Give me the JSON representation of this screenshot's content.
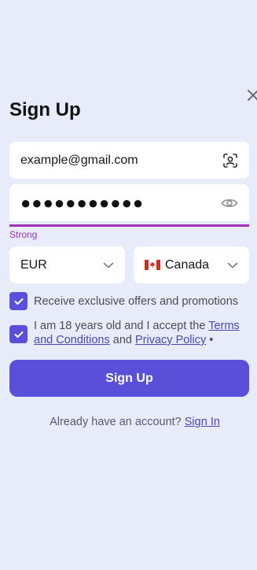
{
  "title": "Sign Up",
  "email": {
    "value": "example@gmail.com",
    "icon": "face-scan-icon"
  },
  "password": {
    "masked_value": "●●●●●●●●●●●",
    "icon": "eye-icon",
    "strength_label": "Strong",
    "strength_color": "#a034b9"
  },
  "currency": {
    "selected": "EUR"
  },
  "country": {
    "selected": "Canada",
    "flag": "canada-flag"
  },
  "checkboxes": {
    "offers": {
      "label": "Receive exclusive offers and promotions",
      "checked": true
    },
    "terms": {
      "prefix": "I am 18 years old and I accept the ",
      "terms_link": "Terms and Conditions",
      "middle": " and ",
      "privacy_link": "Privacy Policy",
      "suffix": " •",
      "checked": true
    }
  },
  "signup_button": {
    "label": "Sign Up"
  },
  "footer": {
    "text": "Already have an account? ",
    "link": "Sign In"
  },
  "colors": {
    "accent": "#5a4fd8",
    "background": "#e8ecfa",
    "strength": "#a034b9"
  }
}
